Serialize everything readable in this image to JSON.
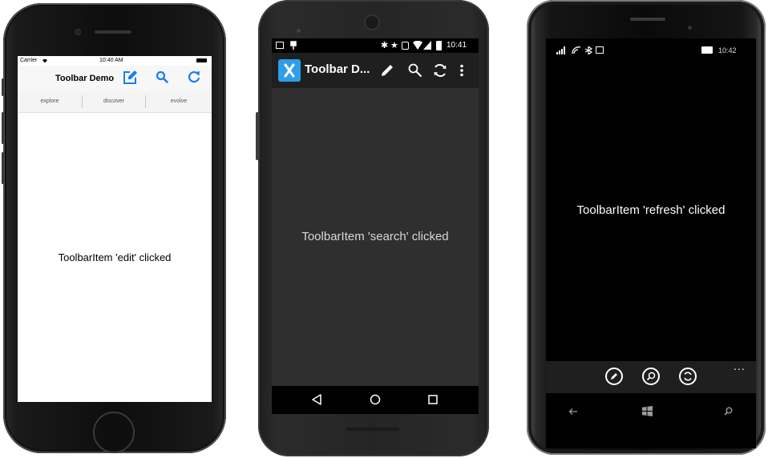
{
  "ios": {
    "status": {
      "carrier": "Carrier",
      "time": "10:40 AM"
    },
    "title": "Toolbar Demo",
    "toolbar_icons": [
      "edit-icon",
      "search-icon",
      "refresh-icon"
    ],
    "tabs": [
      "explore",
      "discover",
      "evolve"
    ],
    "message": "ToolbarItem 'edit' clicked",
    "accent": "#1a7cf5"
  },
  "android": {
    "status": {
      "time": "10:41"
    },
    "title": "Toolbar D...",
    "toolbar_icons": [
      "edit-icon",
      "search-icon",
      "refresh-icon",
      "overflow-menu-icon"
    ],
    "message": "ToolbarItem 'search' clicked",
    "nav_icons": [
      "back-icon",
      "home-icon",
      "recents-icon"
    ],
    "accent": "#2f9ee8"
  },
  "windows_phone": {
    "status": {
      "time": "10:42"
    },
    "message": "ToolbarItem 'refresh' clicked",
    "appbar_icons": [
      "edit-icon",
      "search-icon",
      "refresh-icon"
    ],
    "more": "...",
    "nav_icons": [
      "back-icon",
      "windows-start-icon",
      "search-icon"
    ]
  }
}
